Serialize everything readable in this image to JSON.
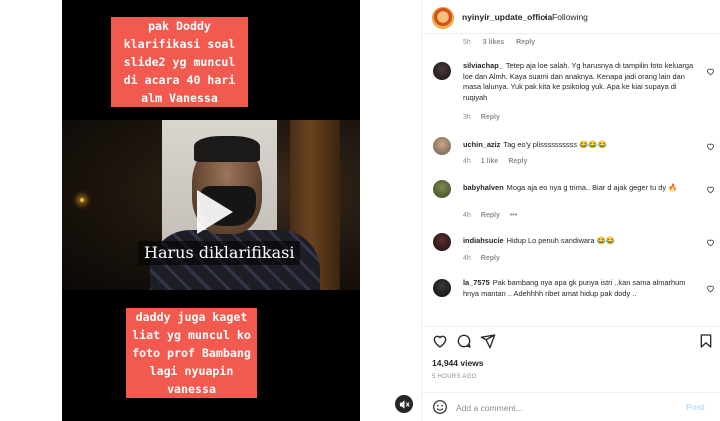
{
  "post": {
    "captions": {
      "top": [
        "pak Doddy",
        "klarifikasi soal",
        "slide2 yg muncul",
        "di acara 40 hari",
        "alm Vanessa"
      ],
      "bottom": [
        "daddy juga kaget",
        "liat yg muncul ko",
        "foto prof Bambang",
        "lagi nyuapin",
        "vanessa"
      ]
    },
    "subtitle": "Harus diklarifikasi",
    "icons": {
      "play": "play-icon",
      "mute": "speaker-muted-icon"
    }
  },
  "header": {
    "username": "nyinyir_update_officia",
    "separator": "•",
    "follow_status": "Following"
  },
  "prev_comment_meta": {
    "time": "5h",
    "likes": "3 likes",
    "reply": "Reply"
  },
  "comments": [
    {
      "username": "silviachap_",
      "text": "Tetep aja loe salah. Yg harusnya di tampilin foto keluarga loe dan Almh. Kaya suami dan anaknya. Kenapa jadi orang lain dan masa lalunya. Yuk pak kita ke psikolog yuk. Apa ke kiai supaya di ruqiyah",
      "time": "3h",
      "likes": "",
      "reply": "Reply",
      "more": ""
    },
    {
      "username": "uchin_aziz",
      "text": "Tag eo'y plissssssssss 😂😂😂",
      "time": "4h",
      "likes": "1 like",
      "reply": "Reply",
      "more": ""
    },
    {
      "username": "babyhalven",
      "text": "Moga aja eo nya g trima.. Biar d ajak geger tu dy 🔥",
      "time": "4h",
      "likes": "",
      "reply": "Reply",
      "more": "•••"
    },
    {
      "username": "indiahsucie",
      "text": "Hidup Lo penuh sandiwara 😂😂",
      "time": "4h",
      "likes": "",
      "reply": "Reply",
      "more": ""
    },
    {
      "username": "la_7575",
      "text": "Pak bambang nya apa gk punya istri ..kan sama almarhum hnya mantan .. Adehhhh ribet amat hidup pak dody ..",
      "time": "",
      "likes": "",
      "reply": "",
      "more": ""
    }
  ],
  "actions": {
    "views": "14,944 views",
    "time_ago": "5 HOURS AGO",
    "add_comment_placeholder": "Add a comment...",
    "post_label": "Post",
    "icons": [
      "heart-icon",
      "comment-icon",
      "share-icon",
      "bookmark-icon",
      "emoji-icon"
    ]
  },
  "colors": {
    "caption_bg": "#f25a4f",
    "link_blue": "#b2dffc",
    "muted_text": "#8e8e8e"
  }
}
